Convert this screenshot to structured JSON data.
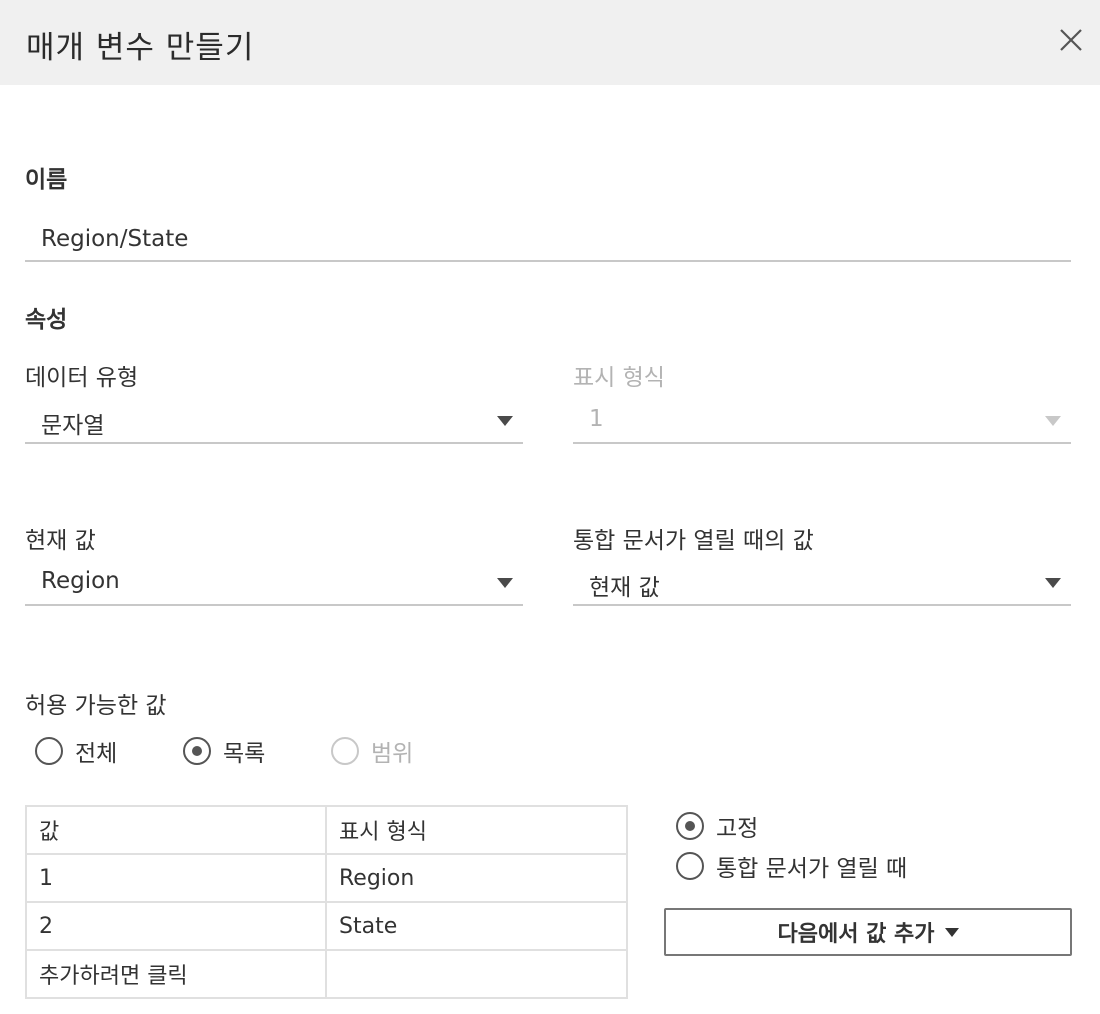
{
  "dialog": {
    "title": "매개 변수 만들기"
  },
  "name_section": {
    "label": "이름",
    "value": "Region/State"
  },
  "properties": {
    "label": "속성",
    "data_type": {
      "label": "데이터 유형",
      "value": "문자열"
    },
    "display_format": {
      "label": "표시 형식",
      "value": "1"
    },
    "current_value": {
      "label": "현재 값",
      "value": "Region"
    },
    "workbook_open_value": {
      "label": "통합 문서가 열릴 때의 값",
      "value": "현재 값"
    }
  },
  "allowable_values": {
    "label": "허용 가능한 값",
    "options": [
      {
        "label": "전체",
        "selected": false,
        "disabled": false
      },
      {
        "label": "목록",
        "selected": true,
        "disabled": false
      },
      {
        "label": "범위",
        "selected": false,
        "disabled": true
      }
    ]
  },
  "value_list": {
    "headers": [
      "값",
      "표시 형식"
    ],
    "rows": [
      [
        "1",
        "Region"
      ],
      [
        "2",
        "State"
      ]
    ],
    "add_row_placeholder": "추가하려면 클릭"
  },
  "list_source": {
    "options": [
      {
        "label": "고정",
        "selected": true
      },
      {
        "label": "통합 문서가 열릴 때",
        "selected": false
      }
    ],
    "add_from_button": "다음에서 값 추가"
  }
}
